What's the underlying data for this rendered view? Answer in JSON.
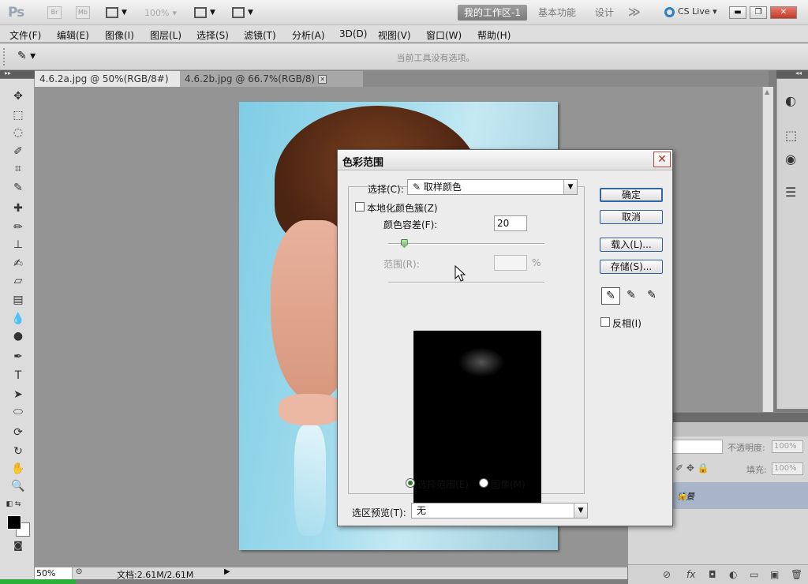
{
  "app": {
    "logo": "Ps",
    "bridge_btn": "Br",
    "minibridge_btn": "Mb",
    "zoom_level": "100%",
    "workspaces": [
      "我的工作区-1",
      "基本功能",
      "设计"
    ],
    "overflow": "≫",
    "cs_live": "CS Live",
    "window_controls": {
      "minimize": "▬",
      "restore": "❐",
      "close": "✕"
    }
  },
  "menu": [
    "文件(F)",
    "编辑(E)",
    "图像(I)",
    "图层(L)",
    "选择(S)",
    "滤镜(T)",
    "分析(A)",
    "3D(D)",
    "视图(V)",
    "窗口(W)",
    "帮助(H)"
  ],
  "options_bar": {
    "hint": "当前工具没有选项。"
  },
  "tabs": [
    {
      "label": "4.6.2a.jpg @ 50%(RGB/8#)",
      "close": "✕"
    },
    {
      "label": "4.6.2b.jpg @ 66.7%(RGB/8)",
      "close": "✕"
    }
  ],
  "status": {
    "zoom": "50%",
    "doc_info": "文档:2.61M/2.61M"
  },
  "layers": {
    "opacity_label": "不透明度:",
    "opacity_value": "100%",
    "fill_label": "填充:",
    "fill_value": "100%",
    "layer_name": "背景"
  },
  "dialog": {
    "title": "色彩范围",
    "select_label": "选择(C):",
    "select_value": "取样颜色",
    "localized_label": "本地化颜色簇(Z)",
    "fuzziness_label": "颜色容差(F):",
    "fuzziness_value": "20",
    "fuzziness_fraction": 0.1,
    "range_label": "范围(R):",
    "range_unit": "%",
    "radio_selection": "选择范围(E)",
    "radio_image": "图像(M)",
    "preview_label": "选区预览(T):",
    "preview_value": "无",
    "buttons": {
      "ok": "确定",
      "cancel": "取消",
      "load": "载入(L)...",
      "save": "存储(S)..."
    },
    "invert_label": "反相(I)"
  },
  "colors": {
    "accent": "#2d7fc3",
    "close_red": "#c23a26",
    "selection_green": "#2d7a2d"
  }
}
